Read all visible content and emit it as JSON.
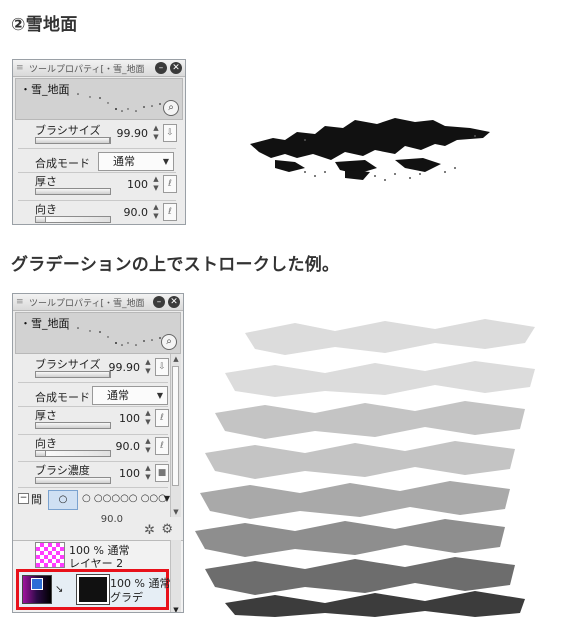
{
  "section1": {
    "heading": "②雪地面",
    "panel": {
      "title": "ツールプロパティ[・雪_地面",
      "preview_label": "・雪_地面",
      "rows": [
        {
          "label": "ブラシサイズ",
          "value": "99.90"
        },
        {
          "label": "合成モード",
          "select": "通常"
        },
        {
          "label": "厚さ",
          "value": "100"
        },
        {
          "label": "向き",
          "value": "90.0"
        }
      ]
    }
  },
  "section2": {
    "heading": "グラデーションの上でストロークした例。",
    "panel": {
      "title": "ツールプロパティ[・雪_地面",
      "preview_label": "・雪_地面",
      "rows": [
        {
          "label": "ブラシサイズ",
          "value": "99.90"
        },
        {
          "label": "合成モード",
          "select": "通常"
        },
        {
          "label": "厚さ",
          "value": "100"
        },
        {
          "label": "向き",
          "value": "90.0"
        },
        {
          "label": "ブラシ濃度",
          "value": "100"
        }
      ],
      "interval_label": "間",
      "interval_options": "○ ○○○○○ ○○○",
      "partial_value": "90.0",
      "layers": [
        {
          "opacity_mode": "100 % 通常",
          "name": "レイヤー 2"
        },
        {
          "opacity_mode": "100 % 通常",
          "name": "グラデ"
        }
      ]
    }
  },
  "colors": {
    "highlight": "#e8111b",
    "checker": "#ff3cff"
  },
  "icons": [
    "close-icon",
    "minimize-icon",
    "magnifier-icon",
    "spin-icon",
    "pressure-icon",
    "caret-icon",
    "settings-icon",
    "wrench-icon"
  ]
}
